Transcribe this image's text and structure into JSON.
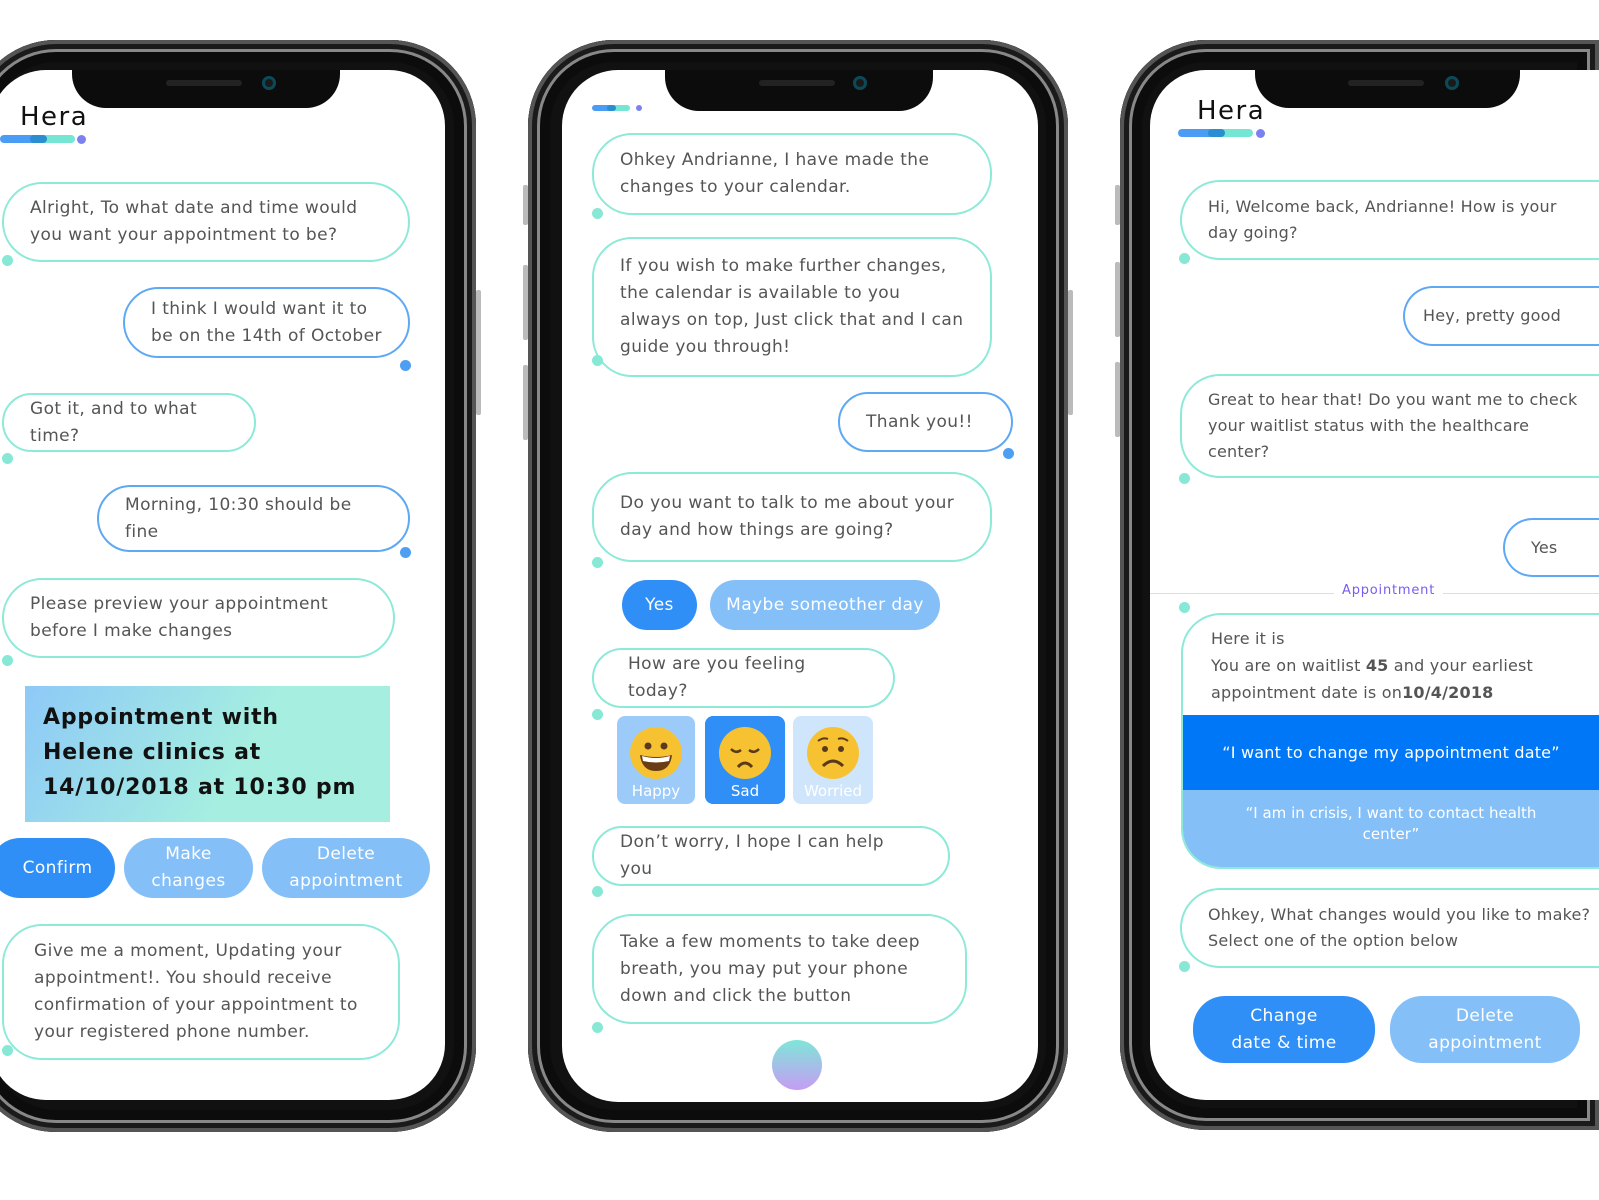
{
  "colors": {
    "accent": "#2f8ff7",
    "light_accent": "#84bff8",
    "teal": "#8de9d8",
    "option_dark": "#0077f7",
    "divider_label": "#7a5cf0"
  },
  "phone1": {
    "app_title": "Hera",
    "messages": [
      {
        "from": "bot",
        "text": "Alright, To what date and time would you want your appointment to be?"
      },
      {
        "from": "user",
        "text": "I think I would want it to be on the 14th of October"
      },
      {
        "from": "bot",
        "text": "Got it, and to what time?"
      },
      {
        "from": "user",
        "text": "Morning, 10:30 should be fine"
      },
      {
        "from": "bot",
        "text": "Please preview your appointment before I make changes"
      },
      {
        "from": "bot",
        "text": "Give me a moment, Updating your appointment!. You should receive confirmation of your appointment to your registered phone number."
      }
    ],
    "appointment_card": "Appointment with Helene clinics at 14/10/2018 at 10:30 pm",
    "buttons": {
      "confirm": "Confirm",
      "make_changes": "Make changes",
      "delete": "Delete appointment"
    }
  },
  "phone2": {
    "messages": [
      {
        "from": "bot",
        "text": "Ohkey Andrianne, I have made the changes to your calendar."
      },
      {
        "from": "bot",
        "text": "If you wish to make further changes, the calendar is available to you always on top, Just click that and I can guide you through!"
      },
      {
        "from": "user",
        "text": "Thank you!!"
      },
      {
        "from": "bot",
        "text": "Do you want to talk to me about your day and how things are going?"
      },
      {
        "from": "bot",
        "text": "How are you feeling today?"
      },
      {
        "from": "bot",
        "text": "Don’t worry, I hope I can help you"
      },
      {
        "from": "bot",
        "text": "Take a few moments to take deep breath, you may put your phone down and click the button"
      }
    ],
    "quick_replies": {
      "yes": "Yes",
      "maybe": "Maybe someother day"
    },
    "moods": [
      {
        "label": "Happy",
        "icon": "grinning-face-icon",
        "selected": false
      },
      {
        "label": "Sad",
        "icon": "sad-face-icon",
        "selected": true
      },
      {
        "label": "Worried",
        "icon": "worried-face-icon",
        "selected": false
      }
    ]
  },
  "phone3": {
    "app_title": "Hera",
    "messages": [
      {
        "from": "bot",
        "text": "Hi, Welcome back, Andrianne! How is your day going?"
      },
      {
        "from": "user",
        "text": "Hey, pretty good"
      },
      {
        "from": "bot",
        "text": "Great to hear that! Do you want me to check your waitlist status with the healthcare center?"
      },
      {
        "from": "user",
        "text": "Yes"
      },
      {
        "from": "bot",
        "text": "Ohkey, What changes would you like to make? Select one of the option below"
      }
    ],
    "divider_label": "Appointment",
    "card": {
      "line1": "Here it is",
      "line2_a": "You are on waitlist ",
      "waitlist": "45",
      "line2_b": " and your earliest appointment date is on",
      "date": "10/4/2018"
    },
    "options": [
      "“I want to change my appointment date”",
      "“I am in crisis, I want to contact health center”"
    ],
    "buttons": {
      "change": "Change date & time",
      "delete": "Delete appointment"
    }
  }
}
